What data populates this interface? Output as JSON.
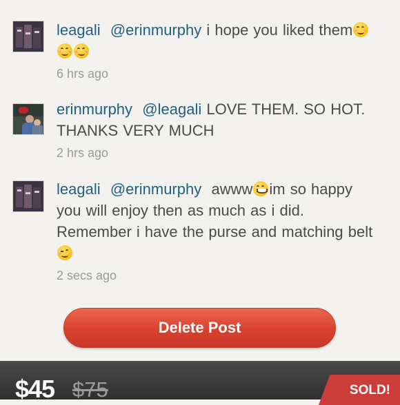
{
  "comments": [
    {
      "username": "leagali",
      "mention": "@erinmurphy",
      "text_before": "i hope you liked them",
      "emojis": [
        "smiling-blush",
        "smiling-blush",
        "smiling-blush"
      ],
      "text_after": "",
      "time": "6 hrs ago"
    },
    {
      "username": "erinmurphy",
      "mention": "@leagali",
      "text_before": "LOVE THEM. SO HOT. THANKS VERY MUCH",
      "time": "2 hrs ago"
    },
    {
      "username": "leagali",
      "mention": "@erinmurphy",
      "text_before": "awww",
      "emoji_mid": "grinning",
      "text_mid": "im so happy you will enjoy then as much as i did. Remember i have the purse and matching belt",
      "emoji_end": "winking",
      "time": "2 secs ago"
    }
  ],
  "delete_button_label": "Delete Post",
  "listing": {
    "price": "$45",
    "original_price": "$75",
    "status": "SOLD!"
  },
  "colors": {
    "username": "#1d5f86",
    "delete_button": "#d8412f",
    "sold_ribbon": "#cc3d39"
  }
}
